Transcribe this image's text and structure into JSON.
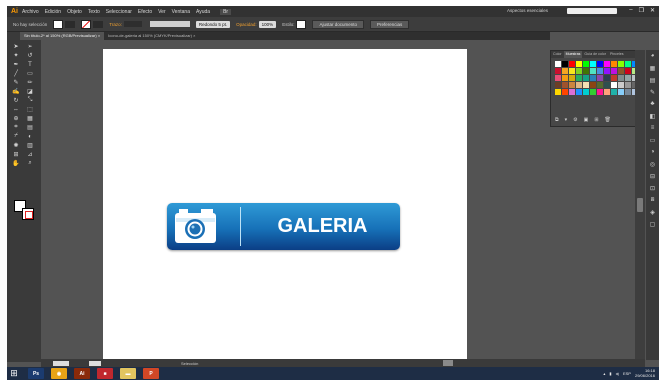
{
  "menubar": {
    "logo": "Ai",
    "items": [
      "Archivo",
      "Edición",
      "Objeto",
      "Texto",
      "Seleccionar",
      "Efecto",
      "Ver",
      "Ventana",
      "Ayuda"
    ],
    "bridge_label": "Br",
    "essentials": "Aspectos esenciales",
    "search_placeholder": ""
  },
  "controlbar": {
    "selection_label": "No hay selección",
    "stroke_label": "Trazo:",
    "brush_label": "Redondo 5 pt.",
    "opacity_label": "Opacidad:",
    "opacity_value": "100%",
    "style_label": "Estilo:",
    "doc_setup_button": "Ajustar documento",
    "preferences_button": "Preferencias"
  },
  "tabs": [
    {
      "label": "Sin título-2* al 150% (RGB/Previsualizar)",
      "active": true
    },
    {
      "label": "Icono-de-galeria al 150% (CMYK/Previsualizar)",
      "active": false
    }
  ],
  "artwork": {
    "button_label": "GALERIA",
    "colors": {
      "top": "#2f9ad6",
      "mid": "#1771b8",
      "bottom": "#0b3e85",
      "icon": "#ffffff"
    }
  },
  "swatches_panel": {
    "tabs": [
      "Color",
      "Muestras",
      "Guía de color",
      "Pinceles"
    ],
    "active_tab": "Muestras",
    "colors": [
      "#ffffff",
      "#000000",
      "#ff0000",
      "#ffff00",
      "#00ff00",
      "#00ffff",
      "#0000ff",
      "#ff00ff",
      "#ff8800",
      "#88ff00",
      "#00ff88",
      "#0088ff",
      "#c8102e",
      "#f5a623",
      "#f8e71c",
      "#7ed321",
      "#417505",
      "#50e3c2",
      "#4a90e2",
      "#9013fe",
      "#bd10e0",
      "#8b572a",
      "#d0021b",
      "#b8e986",
      "#e94e77",
      "#f39c12",
      "#d4ac0d",
      "#27ae60",
      "#16a085",
      "#2980b9",
      "#8e44ad",
      "#2c3e50",
      "#c0392b",
      "#7f8c8d",
      "#95a5a6",
      "#bdc3c7",
      "#6b3e26",
      "#a0522d",
      "#cd853f",
      "#deb887",
      "#f5deb3",
      "#8b4513",
      "#556b2f",
      "#2f4f4f",
      "#ffffff",
      "#cccccc",
      "#999999",
      "#666666",
      "#ffd700",
      "#ff4500",
      "#da70d6",
      "#1e90ff",
      "#00ced1",
      "#32cd32",
      "#ff1493",
      "#ffa07a",
      "#20b2aa",
      "#87cefa",
      "#778899",
      "#b0c4de"
    ]
  },
  "statusbar": {
    "zoom": "150%",
    "page": "1",
    "status_text": "Selección"
  },
  "taskbar": {
    "apps": [
      {
        "label": "Ps",
        "color": "#1b3b6f"
      },
      {
        "label": "",
        "color": "#e8a317"
      },
      {
        "label": "Ai",
        "color": "#8a2a0a"
      },
      {
        "label": "",
        "color": "#c0282e"
      },
      {
        "label": "",
        "color": "#e2c560"
      },
      {
        "label": "P",
        "color": "#d24726"
      }
    ],
    "language": "ESP",
    "time": "16:18",
    "date": "29/06/2016"
  }
}
